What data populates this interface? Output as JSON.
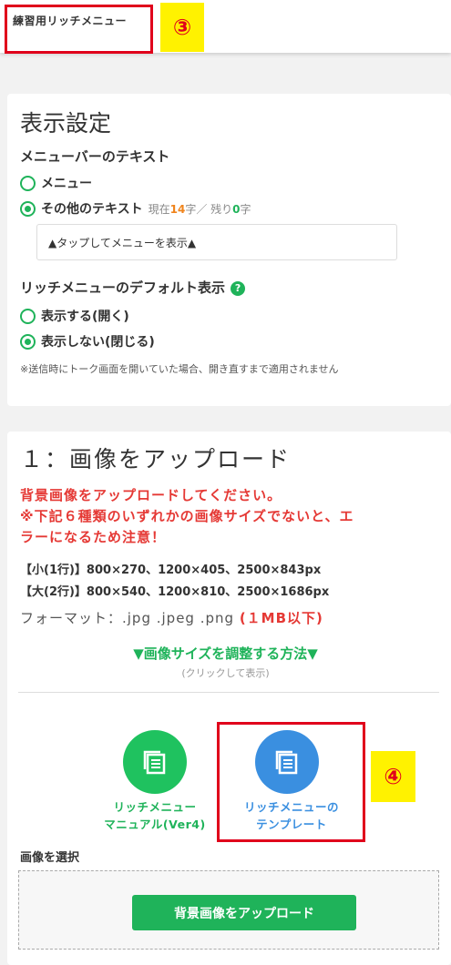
{
  "header": {
    "title": "練習用リッチメニュー",
    "badge3": "③"
  },
  "display_settings": {
    "title": "表示設定",
    "menubar_text_heading": "メニューバーのテキスト",
    "options": [
      {
        "label": "メニュー",
        "checked": false
      },
      {
        "label": "その他のテキスト",
        "checked": true
      }
    ],
    "count_prefix": "現在",
    "count_current": "14",
    "count_mid": "字／ 残り",
    "count_remaining": "0",
    "count_suffix": "字",
    "text_value": "▲タップしてメニューを表示▲",
    "default_display_heading": "リッチメニューのデフォルト表示",
    "help_icon": "?",
    "default_options": [
      {
        "label": "表示する(開く)",
        "checked": false
      },
      {
        "label": "表示しない(閉じる)",
        "checked": true
      }
    ],
    "note": "※送信時にトーク画面を開いていた場合、開き直すまで適用されません"
  },
  "upload_section": {
    "title": "１：画像をアップロード",
    "warning_1": "背景画像をアップロードしてください。",
    "warning_2": "※下記６種類のいずれかの画像サイズでないと、エ",
    "warning_3": "ラーになるため注意！",
    "size_small": "【小(1行)】800×270、1200×405、2500×843px",
    "size_large": "【大(2行)】800×540、1200×810、2500×1686px",
    "format_prefix": "フォーマット：.jpg  .jpeg  .png",
    "format_limit": "(１MB以下)",
    "howto_link": "▼画像サイズを調整する方法▼",
    "howto_sub": "(クリックして表示)",
    "manual_label_1": "リッチメニュー",
    "manual_label_2": "マニュアル(Ver4)",
    "template_label_1": "リッチメニューの",
    "template_label_2": "テンプレート",
    "badge4": "④",
    "select_label": "画像を選択",
    "upload_button": "背景画像をアップロード"
  },
  "colors": {
    "green": "#1fb35a",
    "blue": "#3a8fe0",
    "red": "#e53935",
    "orange": "#f0841c",
    "annotation_red": "#e0001b",
    "annotation_yellow": "#fff200"
  },
  "icons": {
    "manual": "copy-icon",
    "template": "copy-icon"
  }
}
